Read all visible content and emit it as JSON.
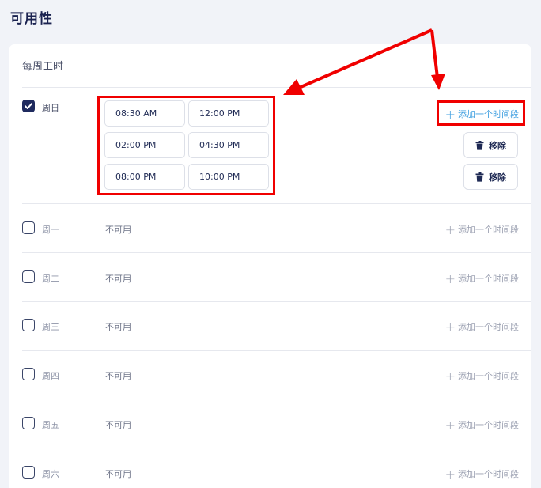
{
  "page": {
    "title": "可用性"
  },
  "card": {
    "title": "每周工时"
  },
  "days": [
    {
      "label": "周日",
      "checked": true,
      "status": ""
    },
    {
      "label": "周一",
      "checked": false,
      "status": "不可用"
    },
    {
      "label": "周二",
      "checked": false,
      "status": "不可用"
    },
    {
      "label": "周三",
      "checked": false,
      "status": "不可用"
    },
    {
      "label": "周四",
      "checked": false,
      "status": "不可用"
    },
    {
      "label": "周五",
      "checked": false,
      "status": "不可用"
    },
    {
      "label": "周六",
      "checked": false,
      "status": "不可用"
    }
  ],
  "sunday_slots": [
    {
      "start": "08:30 AM",
      "end": "12:00 PM"
    },
    {
      "start": "02:00 PM",
      "end": "04:30 PM"
    },
    {
      "start": "08:00 PM",
      "end": "10:00 PM"
    }
  ],
  "actions": {
    "add_slot_label": "添加一个时间段",
    "remove_label": "移除"
  },
  "annotation": {
    "color": "#f00000"
  },
  "colors": {
    "accent": "#3f9fe0",
    "checkbox_checked": "#1f2a5e"
  }
}
